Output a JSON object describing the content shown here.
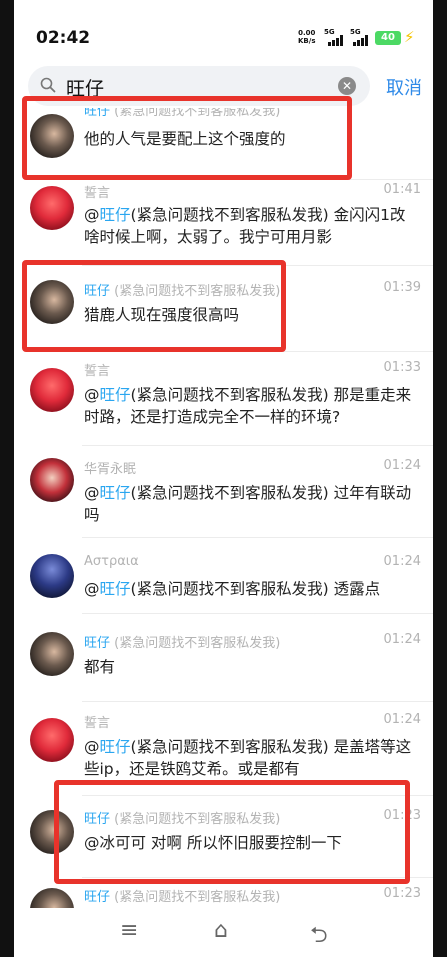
{
  "status": {
    "time": "02:42",
    "netspeed_value": "0.00",
    "netspeed_unit": "KB/s",
    "sig1": "5G",
    "sig2": "5G",
    "battery": "40"
  },
  "search": {
    "query": "旺仔",
    "cancel_label": "取消"
  },
  "messages": [
    {
      "sender": "",
      "group": "",
      "time": "",
      "body_plain": "他的人气是要配上这个强度的"
    },
    {
      "sender": "誓言",
      "group": "",
      "time": "01:41",
      "at_prefix": "@",
      "at_name": "旺仔",
      "at_group": "(紧急问题找不到客服私发我)",
      "body": "金闪闪1改啥时候上啊，太弱了。我宁可用月影"
    },
    {
      "sender": "旺仔",
      "group": "(紧急问题找不到客服私发我)",
      "time": "01:39",
      "body_plain": "猎鹿人现在强度很高吗"
    },
    {
      "sender": "誓言",
      "group": "",
      "time": "01:33",
      "at_prefix": "@",
      "at_name": "旺仔",
      "at_group": "(紧急问题找不到客服私发我)",
      "body": "那是重走来时路，还是打造成完全不一样的环境?"
    },
    {
      "sender": "华胥永眠",
      "group": "",
      "time": "01:24",
      "at_prefix": "@",
      "at_name": "旺仔",
      "at_group": "(紧急问题找不到客服私发我)",
      "body": "过年有联动吗"
    },
    {
      "sender": "Αστραια",
      "group": "",
      "time": "01:24",
      "at_prefix": "@",
      "at_name": "旺仔",
      "at_group": "(紧急问题找不到客服私发我)",
      "body": "透露点"
    },
    {
      "sender": "旺仔",
      "group": "(紧急问题找不到客服私发我)",
      "time": "01:24",
      "body_plain": "都有"
    },
    {
      "sender": "誓言",
      "group": "",
      "time": "01:24",
      "at_prefix": "@",
      "at_name": "旺仔",
      "at_group": "(紧急问题找不到客服私发我)",
      "body": "是盖塔等这些ip，还是铁鸥艾希。或是都有"
    },
    {
      "sender": "旺仔",
      "group": "(紧急问题找不到客服私发我)",
      "time": "01:23",
      "body_plain": "@冰可可 对啊 所以怀旧服要控制一下"
    },
    {
      "sender": "旺仔",
      "group": "(紧急问题找不到客服私发我)",
      "time": "01:23",
      "body_plain": ""
    }
  ],
  "colors": {
    "accent": "#2aa6f0",
    "highlight_box": "#e8332b"
  },
  "nav": {
    "menu_icon": "≡",
    "home_icon": "⌂",
    "back_icon": "⮌"
  }
}
